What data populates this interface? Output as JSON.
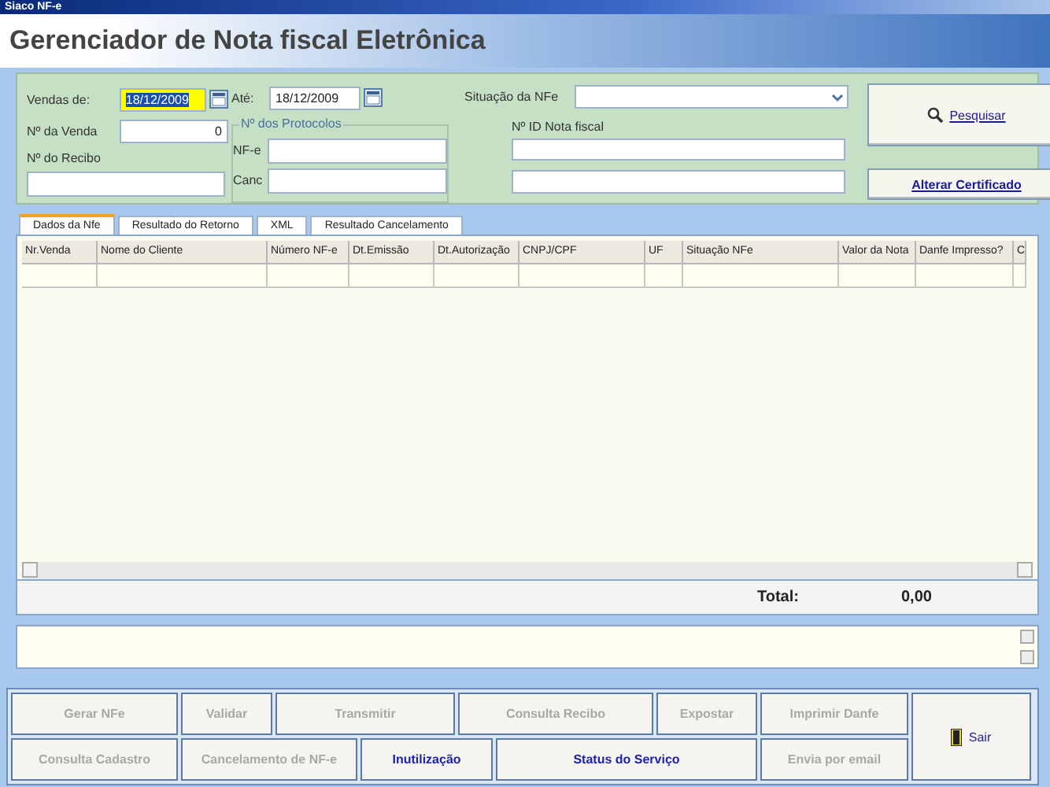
{
  "window": {
    "title": "Siaco NF-e"
  },
  "header": {
    "title": "Gerenciador de Nota fiscal Eletrônica"
  },
  "filters": {
    "vendas_de_label": "Vendas de:",
    "vendas_de": "18/12/2009",
    "vendas_de_selected": true,
    "ate_label": "Até:",
    "ate": "18/12/2009",
    "situacao_label": "Situação da NFe",
    "venda_label": "Nº da Venda",
    "venda": "0",
    "recibo_label": "Nº do Recibo",
    "protocolos_label": "Nº dos Protocolos",
    "nfe_label": "NF-e",
    "canc_label": "Canc",
    "id_label": "Nº ID Nota fiscal"
  },
  "search_button": "Pesquisar",
  "cert_button": "Alterar Certificado",
  "tabs": [
    {
      "label": "Dados da Nfe",
      "selected": true
    },
    {
      "label": "Resultado do Retorno",
      "selected": false
    },
    {
      "label": "XML",
      "selected": false
    },
    {
      "label": "Resultado Cancelamento",
      "selected": false
    }
  ],
  "table": {
    "columns": [
      "Nr.Venda",
      "Nome do Cliente",
      "Número NF-e",
      "Dt.Emissão",
      "Dt.Autorização",
      "CNPJ/CPF",
      "UF",
      "Situação NFe",
      "Valor da Nota",
      "Danfe Impresso?",
      "C"
    ]
  },
  "total": {
    "label": "Total:",
    "value": "0,00"
  },
  "buttons": [
    {
      "label": "Gerar NFe",
      "disabled": true
    },
    {
      "label": "Validar",
      "disabled": true
    },
    {
      "label": "Transmitir",
      "disabled": true
    },
    {
      "label": "Consulta Recibo",
      "disabled": true
    },
    {
      "label": "Expostar",
      "disabled": true
    },
    {
      "label": "Imprimir Danfe",
      "disabled": true
    },
    {
      "label": "Sair",
      "disabled": false
    },
    {
      "label": "Consulta Cadastro",
      "disabled": true
    },
    {
      "label": "Cancelamento de NF-e",
      "disabled": true
    },
    {
      "label": "Inutilização",
      "disabled": false
    },
    {
      "label": "Status do Serviço",
      "disabled": false
    },
    {
      "label": "Envia por email",
      "disabled": true
    }
  ]
}
